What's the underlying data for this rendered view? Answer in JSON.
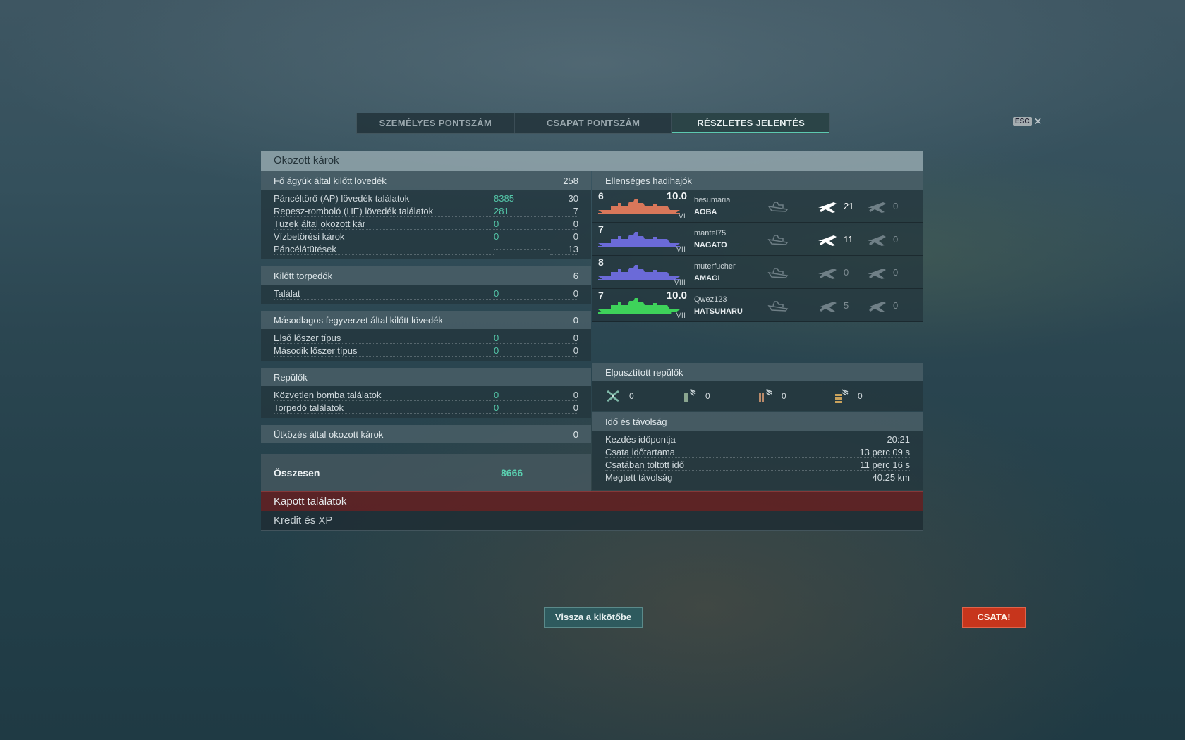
{
  "tabs": [
    {
      "label": "SZEMÉLYES PONTSZÁM",
      "active": false
    },
    {
      "label": "CSAPAT PONTSZÁM",
      "active": false
    },
    {
      "label": "RÉSZLETES JELENTÉS",
      "active": true
    }
  ],
  "esc_label": "ESC",
  "close_glyph": "✕",
  "damage": {
    "title": "Okozott károk",
    "main_guns": {
      "label": "Fő ágyúk által kilőtt lövedék",
      "value": "258",
      "rows": [
        {
          "label": "Páncéltörő (AP) lövedék találatok",
          "dmg": "8385",
          "value": "30"
        },
        {
          "label": "Repesz-romboló (HE) lövedék találatok",
          "dmg": "281",
          "value": "7"
        },
        {
          "label": "Tüzek által okozott kár",
          "dmg": "0",
          "value": "0"
        },
        {
          "label": "Vízbetörési károk",
          "dmg": "0",
          "value": "0"
        },
        {
          "label": "Páncélátütések",
          "dmg": "",
          "value": "13"
        }
      ]
    },
    "torpedoes": {
      "label": "Kilőtt torpedók",
      "value": "6",
      "rows": [
        {
          "label": "Találat",
          "dmg": "0",
          "value": "0"
        }
      ]
    },
    "secondary": {
      "label": "Másodlagos fegyverzet által kilőtt lövedék",
      "value": "0",
      "rows": [
        {
          "label": "Első lőszer típus",
          "dmg": "0",
          "value": "0"
        },
        {
          "label": "Második lőszer típus",
          "dmg": "0",
          "value": "0"
        }
      ]
    },
    "planes": {
      "label": "Repülők",
      "value": "",
      "rows": [
        {
          "label": "Közvetlen bomba találatok",
          "dmg": "0",
          "value": "0"
        },
        {
          "label": "Torpedó találatok",
          "dmg": "0",
          "value": "0"
        }
      ]
    },
    "ramming": {
      "label": "Ütközés által okozott károk",
      "value": "0"
    },
    "total": {
      "label": "Összesen",
      "dmg": "8666"
    }
  },
  "enemy_ships": {
    "title": "Ellenséges hadihajók",
    "ships": [
      {
        "tier_num": "6",
        "damage_pct": "10.0",
        "tier_roman": "VI",
        "player": "hesumaria",
        "name": "AOBA",
        "color": "#d9775a",
        "fill": 1.0,
        "kill_a": "21",
        "kill_b": "0",
        "kill_a_active": true
      },
      {
        "tier_num": "7",
        "damage_pct": "",
        "tier_roman": "VII",
        "player": "mantel75",
        "name": "NAGATO",
        "color": "#6b6ad8",
        "fill": 1.0,
        "kill_a": "11",
        "kill_b": "0",
        "kill_a_active": true
      },
      {
        "tier_num": "8",
        "damage_pct": "",
        "tier_roman": "VIII",
        "player": "muterfucher",
        "name": "AMAGI",
        "color": "#6b6ad8",
        "fill": 1.0,
        "kill_a": "0",
        "kill_b": "0",
        "kill_a_active": false
      },
      {
        "tier_num": "7",
        "damage_pct": "10.0",
        "tier_roman": "VII",
        "player": "Qwez123",
        "name": "HATSUHARU",
        "color": "#3ed25a",
        "fill": 0.9,
        "kill_a": "5",
        "kill_b": "0",
        "kill_a_active": false
      }
    ]
  },
  "destroyed_planes": {
    "title": "Elpusztított repülők",
    "items": [
      {
        "icon": "fighter-icon",
        "value": "0"
      },
      {
        "icon": "bomber-icon",
        "value": "0"
      },
      {
        "icon": "torpedo-bomber-icon",
        "value": "0"
      },
      {
        "icon": "scout-plane-icon",
        "value": "0"
      }
    ]
  },
  "time_distance": {
    "title": "Idő és távolság",
    "rows": [
      {
        "label": "Kezdés időpontja",
        "value": "20:21"
      },
      {
        "label": "Csata időtartama",
        "value": "13 perc 09 s"
      },
      {
        "label": "Csatában töltött idő",
        "value": "11 perc 16 s"
      },
      {
        "label": "Megtett távolság",
        "value": "40.25 km"
      }
    ]
  },
  "sections": {
    "received_hits": "Kapott találatok",
    "credits_xp": "Kredit és XP"
  },
  "buttons": {
    "back_to_port": "Vissza a kikötőbe",
    "battle": "CSATA!"
  },
  "colors": {
    "accent": "#5cc9b1",
    "battle_button": "#c7351c",
    "received_hits_bar": "#641e20"
  }
}
